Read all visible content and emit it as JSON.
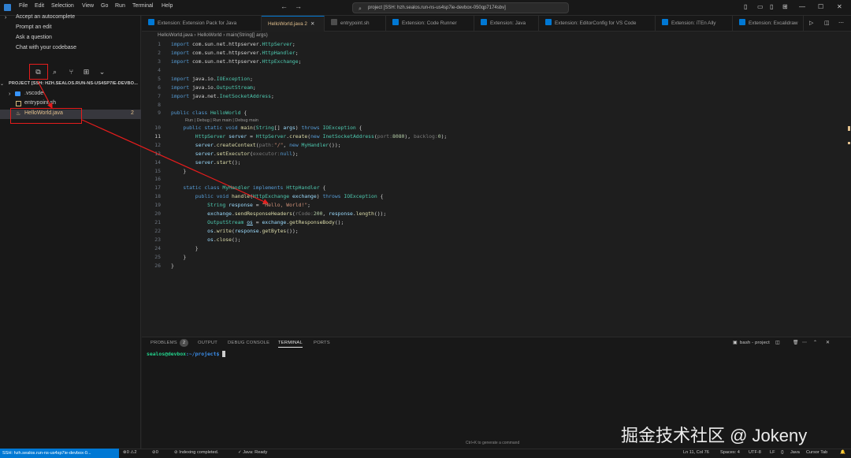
{
  "menu": [
    "File",
    "Edit",
    "Selection",
    "View",
    "Go",
    "Run",
    "Terminal",
    "Help"
  ],
  "command_center": "project [SSH: hzh.sealos.run-ns-us4sp7ie-devbox-050qp7174sbv]",
  "chat_items": [
    "Accept an autocomplete",
    "Prompt an edit",
    "Ask a question",
    "Chat with your codebase"
  ],
  "explorer": {
    "header": "PROJECT [SSH: HZH.SEALOS.RUN-NS-US4SP7IE-DEVBO...",
    "items": [
      ".vscode",
      "entrypoint.sh",
      "HelloWorld.java"
    ],
    "problem_count": "2"
  },
  "tabs": [
    "Extension: Extension Pack for Java",
    "HelloWorld.java 2",
    "entrypoint.sh",
    "Extension: Code Runner",
    "Extension: Java",
    "Extension: EditorConfig for VS Code",
    "Extension: iTEn Ally",
    "Extension: Excalidraw"
  ],
  "breadcrumb": [
    "HelloWorld.java",
    "HelloWorld",
    "main(String[] args)"
  ],
  "codelens": "Run | Debug | Run main | Debug main",
  "line_numbers": [
    "1",
    "2",
    "3",
    "4",
    "5",
    "6",
    "7",
    "8",
    "9",
    "10",
    "11",
    "12",
    "13",
    "14",
    "15",
    "16",
    "17",
    "18",
    "19",
    "20",
    "21",
    "22",
    "23",
    "24",
    "25",
    "26"
  ],
  "panel": {
    "tabs": [
      "PROBLEMS",
      "OUTPUT",
      "DEBUG CONSOLE",
      "TERMINAL",
      "PORTS"
    ],
    "problems_badge": "2",
    "terminal_label": "bash - project",
    "prompt_user": "sealos@devbox",
    "prompt_path": ":~/project$"
  },
  "hint": "Ctrl+K to generate a command",
  "status": {
    "remote": "SSH: hzh.sealos.run-ns-us4sp7ie-devbox-0...",
    "errors": "0",
    "warnings": "2",
    "ports": "0",
    "indexing": "Indexing completed.",
    "java": "Java: Ready",
    "position": "Ln 11, Col 76",
    "spaces": "Spaces: 4",
    "encoding": "UTF-8",
    "eol": "LF",
    "language": "Java",
    "cursor": "Cursor Tab"
  },
  "watermark": "掘金技术社区 @ Jokeny",
  "colors": {
    "accent": "#0078d4",
    "annotation": "#e51c1c",
    "java_file": "#e2c08d"
  }
}
